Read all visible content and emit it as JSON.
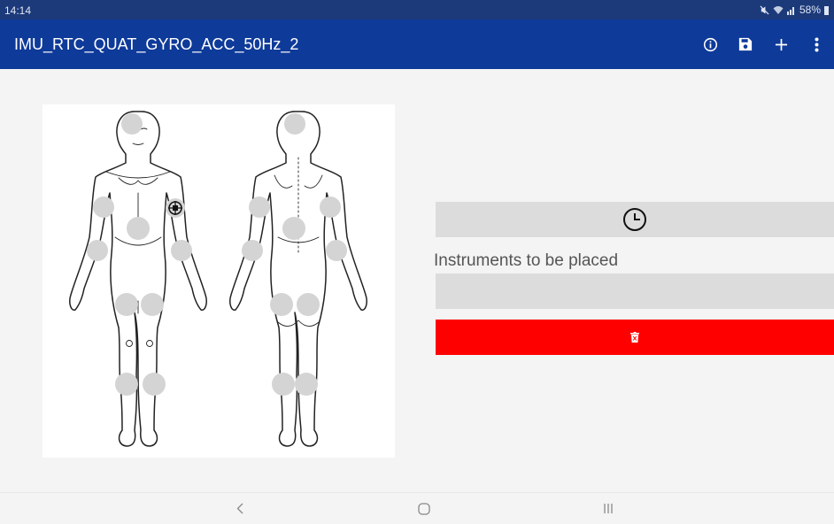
{
  "status_bar": {
    "time": "14:14",
    "battery": "58%"
  },
  "app_bar": {
    "title": "IMU_RTC_QUAT_GYRO_ACC_50Hz_2",
    "actions": [
      "info-icon",
      "save-icon",
      "add-icon",
      "more-vert-icon"
    ]
  },
  "panel": {
    "instruments_label": "Instruments to be placed",
    "instruments_value": ""
  },
  "colors": {
    "app_bar": "#0e3a99",
    "status_bar": "#1c3a7a",
    "delete_button": "#ff0000",
    "placeholder_spot": "#d4d4d4",
    "field_bg": "#dcdcdc"
  },
  "nav_bar": {
    "buttons": [
      "back-icon",
      "home-icon",
      "recents-icon"
    ]
  }
}
